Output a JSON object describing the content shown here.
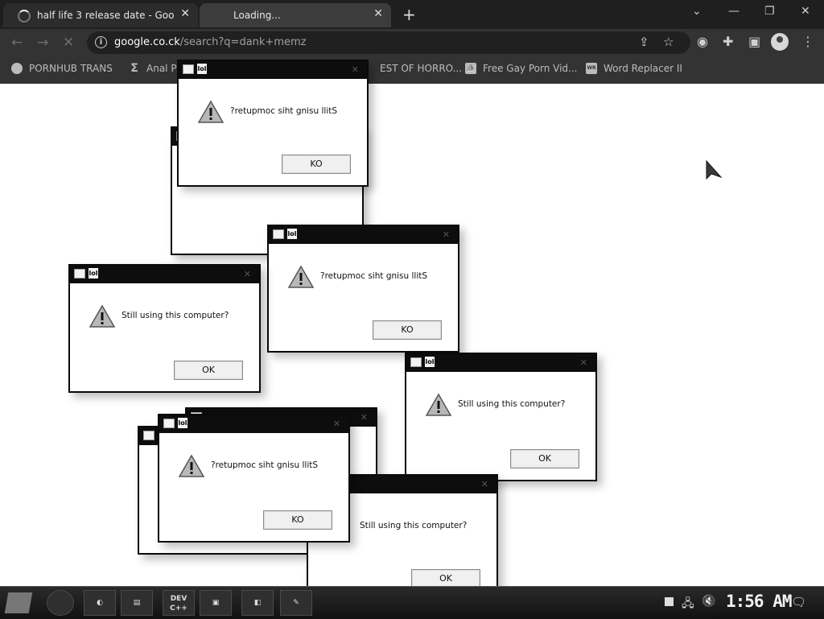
{
  "browser": {
    "tabs": [
      {
        "label": "half life 3 release date - Goog"
      },
      {
        "label": "Loading..."
      }
    ],
    "new_tab": "+",
    "close_glyph": "✕",
    "url_host": "google.co.ck",
    "url_path": "/search?q=dank+memz",
    "bookmarks": [
      {
        "label": "PORNHUB TRANS",
        "icon": "globe-icon"
      },
      {
        "label": "Anal Pi",
        "icon": "sigma-icon"
      },
      {
        "label": "EST OF HORRO...",
        "icon": "globe-icon"
      },
      {
        "label": "Free Gay Porn Vid...",
        "icon": "boat-icon"
      },
      {
        "label": "Word Replacer II",
        "icon": "wr-icon",
        "icon_text": "WR"
      }
    ]
  },
  "dialogs": [
    {
      "message": "",
      "button": ""
    },
    {
      "message": "?retupmoc siht gnisu llitS",
      "button": "KO"
    },
    {
      "message": "?retupmoc siht gnisu llitS",
      "button": "KO"
    },
    {
      "message": "Still using this computer?",
      "button": "OK"
    },
    {
      "message": "Still using this computer?",
      "button": "OK"
    },
    {
      "message": "",
      "button": ""
    },
    {
      "message": "",
      "button": ""
    },
    {
      "message": "?retupmoc siht gnisu llitS",
      "button": "KO"
    },
    {
      "message": "Still using this computer?",
      "button": "OK"
    }
  ],
  "dialog_icon_text": "lol",
  "taskbar": {
    "apps": [
      {
        "name": "chrome",
        "label": ""
      },
      {
        "name": "firefox",
        "label": ""
      },
      {
        "name": "save",
        "label": ""
      },
      {
        "name": "devcpp",
        "label": "DEV C++"
      },
      {
        "name": "media",
        "label": ""
      },
      {
        "name": "notes",
        "label": ""
      },
      {
        "name": "paint",
        "label": ""
      }
    ],
    "clock": "1:56 AM"
  }
}
